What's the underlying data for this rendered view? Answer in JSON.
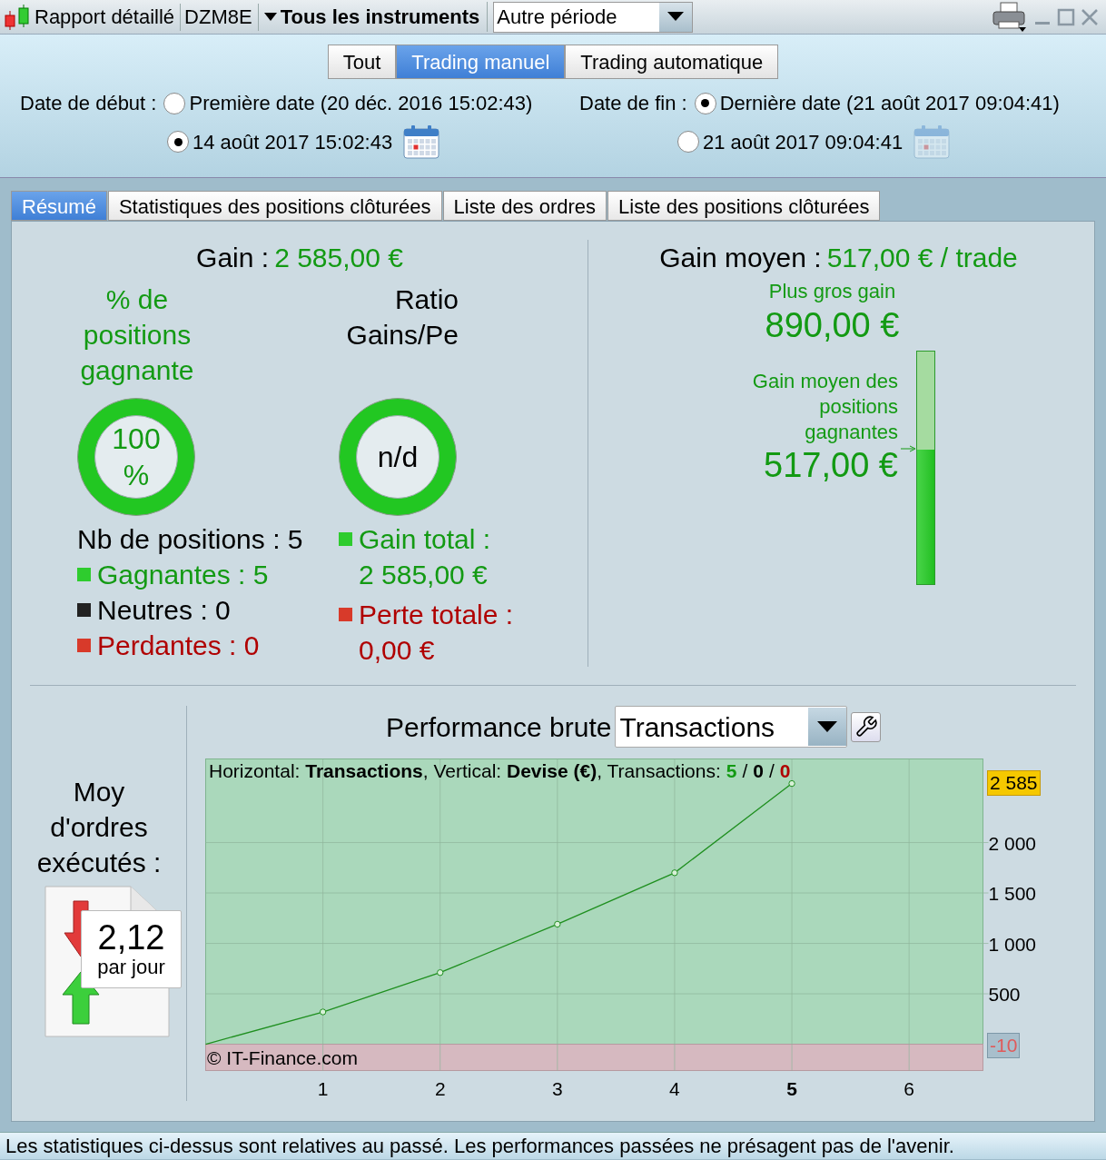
{
  "toolbar": {
    "title": "Rapport détaillé",
    "account": "DZM8E",
    "instruments": "Tous les instruments",
    "period": "Autre période"
  },
  "mode_tabs": [
    {
      "label": "Tout",
      "selected": false
    },
    {
      "label": "Trading manuel",
      "selected": true
    },
    {
      "label": "Trading automatique",
      "selected": false
    }
  ],
  "start": {
    "label": "Date de début :",
    "options": [
      {
        "kind": "preset",
        "label": "Première date (20 déc. 2016 15:02:43)",
        "selected": false
      },
      {
        "kind": "custom",
        "label": "14 août 2017 15:02:43",
        "selected": true
      }
    ]
  },
  "end": {
    "label": "Date de fin :",
    "options": [
      {
        "kind": "preset",
        "label": "Dernière date (21 août 2017 09:04:41)",
        "selected": true
      },
      {
        "kind": "custom",
        "label": "21 août 2017 09:04:41",
        "selected": false
      }
    ]
  },
  "tabs": [
    {
      "label": "Résumé",
      "selected": true
    },
    {
      "label": "Statistiques des positions clôturées",
      "selected": false
    },
    {
      "label": "Liste des ordres",
      "selected": false
    },
    {
      "label": "Liste des positions clôturées",
      "selected": false
    }
  ],
  "summary": {
    "gain_label": "Gain :",
    "gain_value": "2 585,00 €",
    "win_rate": {
      "title_lines": [
        "% de",
        "positions",
        "gagnante"
      ],
      "value_lines": [
        "100",
        "%"
      ]
    },
    "ratio": {
      "title_lines": [
        "Ratio",
        "Gains/Pe"
      ],
      "value": "n/d"
    },
    "positions": "Nb de positions : 5",
    "breakdown": [
      {
        "kind": "win",
        "label": "Gagnantes : 5"
      },
      {
        "kind": "neutral",
        "label": "Neutres : 0"
      },
      {
        "kind": "loss",
        "label": "Perdantes : 0"
      }
    ],
    "totals": [
      {
        "kind": "win",
        "label": "Gain total :",
        "value": "2 585,00 €"
      },
      {
        "kind": "loss",
        "label": "Perte totale :",
        "value": "0,00 €"
      }
    ]
  },
  "average": {
    "label": "Gain moyen :",
    "value": "517,00 € / trade",
    "max_label": "Plus gros gain",
    "max_value": "890,00 €",
    "avg_lines": [
      "Gain moyen des",
      "positions",
      "gagnantes"
    ],
    "avg_value": "517,00 €",
    "level": 0.58
  },
  "orders": {
    "label_lines": [
      "Moy",
      "d'ordres",
      "exécutés :"
    ],
    "value": "2,12",
    "unit": "par jour"
  },
  "performance": {
    "title": "Performance brute",
    "mode": "Transactions",
    "info": "Horizontal: **Transactions**, Vertical: **Devise (€)**, Transactions:",
    "counts": [
      {
        "value": "5",
        "color": "#139a13"
      },
      {
        "value": "0",
        "color": "#000000"
      },
      {
        "value": "0",
        "color": "#b00000"
      }
    ],
    "separator": "/",
    "copyright": "© IT-Finance.com",
    "last_label": "2 585",
    "min_label": "-10",
    "chart_data": {
      "type": "line",
      "x": [
        0,
        1,
        2,
        3,
        4,
        5
      ],
      "series": [
        {
          "color": "#1f8f1f",
          "marker": "circle",
          "values": [
            0,
            320,
            710,
            1190,
            1700,
            2585
          ]
        }
      ],
      "grid": true,
      "xlim": [
        0,
        6.63
      ],
      "ylim": [
        -261,
        2829
      ],
      "xticks": [
        1,
        2,
        3,
        4,
        5,
        6
      ],
      "yticks": [
        {
          "value": 500,
          "label": "500"
        },
        {
          "value": 1000,
          "label": "1 000"
        },
        {
          "value": 1500,
          "label": "1 500"
        },
        {
          "value": 2000,
          "label": "2 000"
        }
      ]
    }
  },
  "status": "Les statistiques ci-dessus sont relatives au passé. Les performances passées ne présagent pas de l'avenir."
}
